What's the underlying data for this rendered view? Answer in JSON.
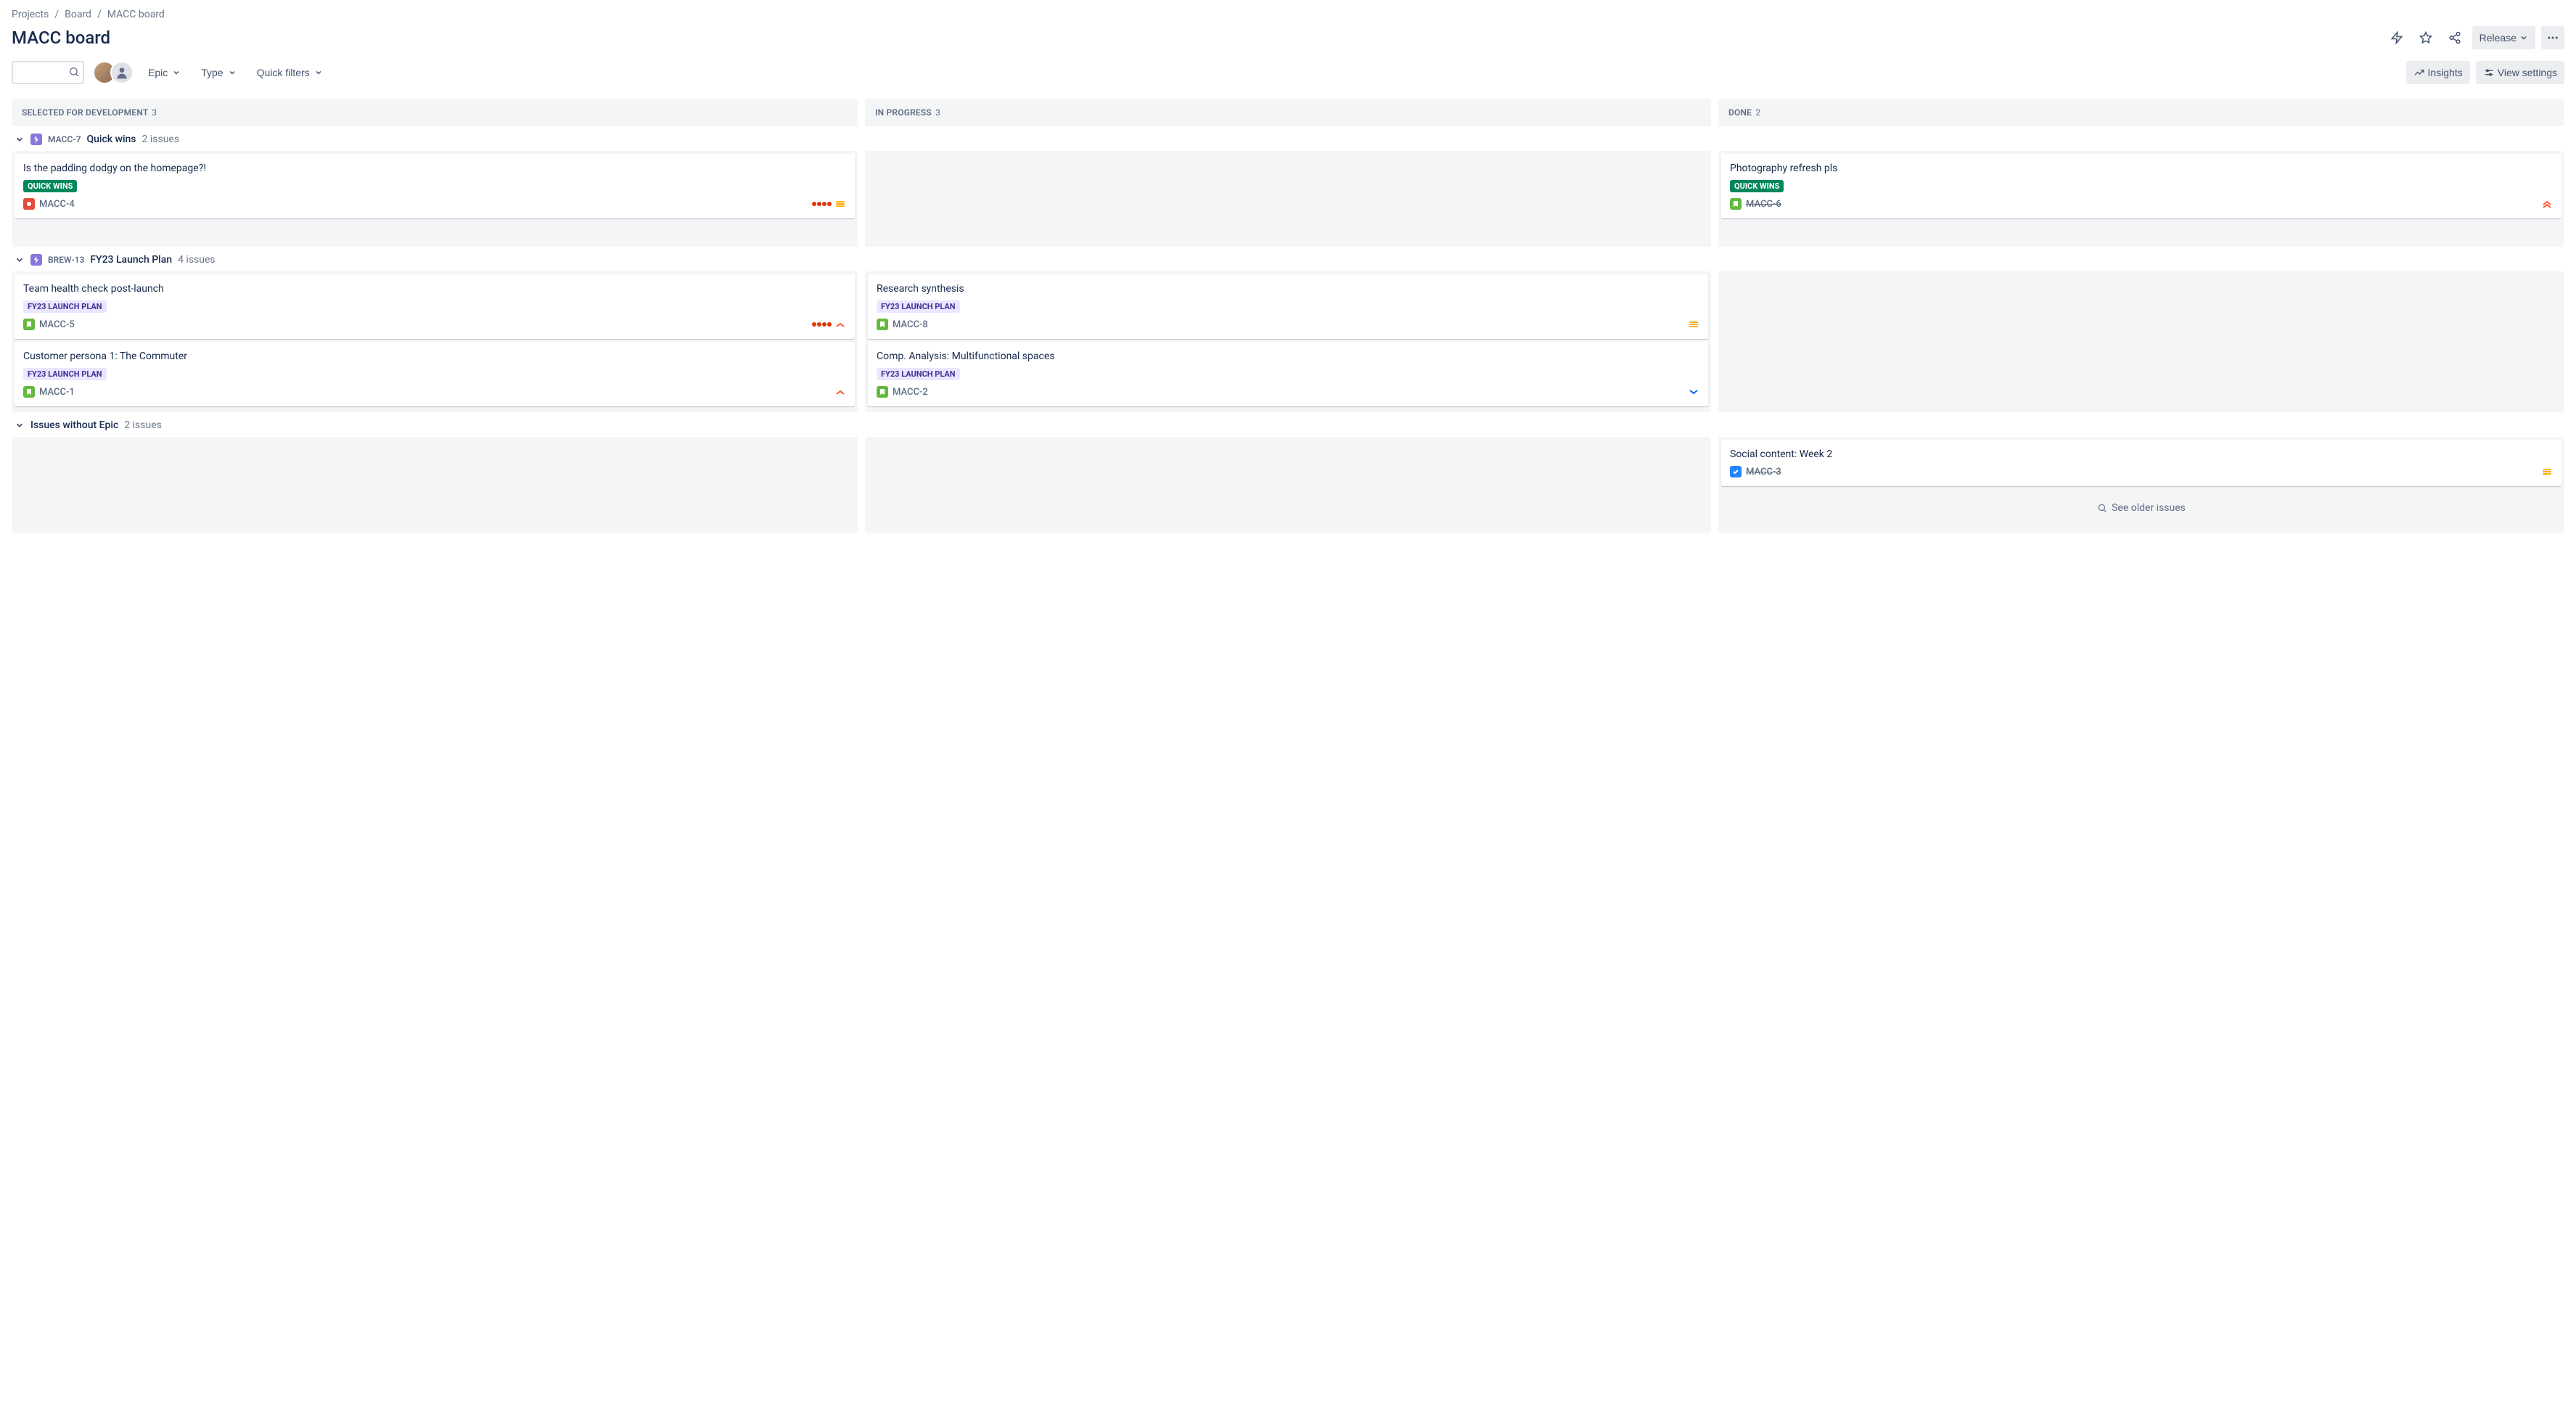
{
  "breadcrumb": {
    "items": [
      "Projects",
      "Board",
      "MACC board"
    ]
  },
  "page_title": "MACC board",
  "header_actions": {
    "release_label": "Release"
  },
  "toolbar": {
    "search_placeholder": "",
    "epic_label": "Epic",
    "type_label": "Type",
    "quick_filters_label": "Quick filters",
    "insights_label": "Insights",
    "view_settings_label": "View settings"
  },
  "columns": [
    {
      "name": "Selected for Development",
      "count": 3
    },
    {
      "name": "In Progress",
      "count": 3
    },
    {
      "name": "Done",
      "count": 2
    }
  ],
  "swimlanes": [
    {
      "type": "epic",
      "epic_key": "MACC-7",
      "epic_title": "Quick wins",
      "issue_count_label": "2 issues",
      "cards": [
        [
          {
            "title": "Is the padding dodgy on the homepage?!",
            "tag": "QUICK WINS",
            "tag_style": "teal",
            "issue_type": "bug",
            "key": "MACC-4",
            "days_dots": 4,
            "priority": "medium"
          }
        ],
        [],
        [
          {
            "title": "Photography refresh pls",
            "tag": "QUICK WINS",
            "tag_style": "teal",
            "issue_type": "story",
            "key": "MACC-6",
            "struck": true,
            "priority": "highest"
          }
        ]
      ]
    },
    {
      "type": "epic",
      "epic_key": "BREW-13",
      "epic_title": "FY23 Launch Plan",
      "issue_count_label": "4 issues",
      "cards": [
        [
          {
            "title": "Team health check post-launch",
            "tag": "FY23 LAUNCH PLAN",
            "tag_style": "purple",
            "issue_type": "story",
            "key": "MACC-5",
            "days_dots": 4,
            "priority": "high"
          },
          {
            "title": "Customer persona 1: The Commuter",
            "tag": "FY23 LAUNCH PLAN",
            "tag_style": "purple",
            "issue_type": "story",
            "key": "MACC-1",
            "priority": "high"
          }
        ],
        [
          {
            "title": "Research synthesis",
            "tag": "FY23 LAUNCH PLAN",
            "tag_style": "purple",
            "issue_type": "story",
            "key": "MACC-8",
            "priority": "medium"
          },
          {
            "title": "Comp. Analysis: Multifunctional spaces",
            "tag": "FY23 LAUNCH PLAN",
            "tag_style": "purple",
            "issue_type": "story",
            "key": "MACC-2",
            "priority": "low"
          }
        ],
        []
      ]
    },
    {
      "type": "noepic",
      "epic_title": "Issues without Epic",
      "issue_count_label": "2 issues",
      "cards": [
        [],
        [],
        [
          {
            "title": "Social content: Week 2",
            "issue_type": "task",
            "key": "MACC-3",
            "struck": true,
            "priority": "medium"
          }
        ]
      ]
    }
  ],
  "see_older_label": "See older issues",
  "colors": {
    "teal": "#00875A",
    "purple": "#8777D9",
    "red": "#DE350B",
    "blue": "#0065FF",
    "yellow": "#FFAB00"
  }
}
